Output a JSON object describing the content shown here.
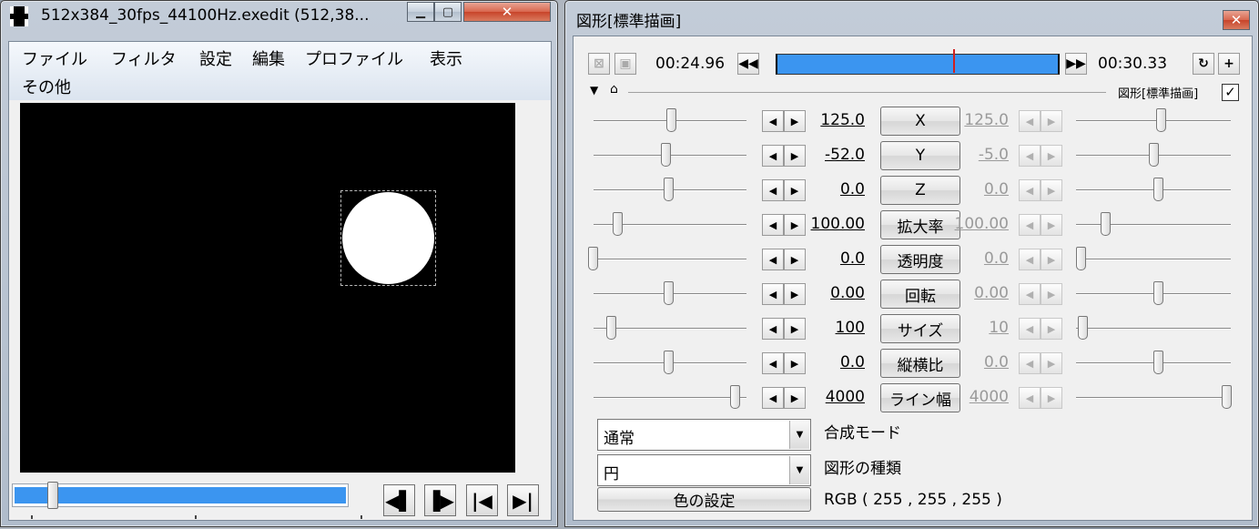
{
  "left_window": {
    "title": "512x384_30fps_44100Hz.exedit (512,38...",
    "menu": [
      "ファイル",
      "フィルタ",
      "設定",
      "編集",
      "プロファイル",
      "表示",
      "その他"
    ],
    "nav_buttons": [
      "◀▌",
      "▐▶",
      "|◀",
      "▶|"
    ]
  },
  "right_window": {
    "title": "図形[標準描画]",
    "time_start": "00:24.96",
    "time_end": "00:30.33",
    "timebar_position": 0.63,
    "object_label": "図形[標準描画]",
    "object_checked": "✓",
    "params": [
      {
        "name": "X",
        "start": "125.0",
        "end": "125.0",
        "thumb_l": 0.55,
        "thumb_r": 0.55
      },
      {
        "name": "Y",
        "start": "-52.0",
        "end": "-5.0",
        "thumb_l": 0.51,
        "thumb_r": 0.5
      },
      {
        "name": "Z",
        "start": "0.0",
        "end": "0.0",
        "thumb_l": 0.53,
        "thumb_r": 0.53
      },
      {
        "name": "拡大率",
        "start": "100.00",
        "end": "100.00",
        "thumb_l": 0.17,
        "thumb_r": 0.17
      },
      {
        "name": "透明度",
        "start": "0.0",
        "end": "0.0",
        "thumb_l": 0.0,
        "thumb_r": 0.0
      },
      {
        "name": "回転",
        "start": "0.00",
        "end": "0.00",
        "thumb_l": 0.53,
        "thumb_r": 0.53
      },
      {
        "name": "サイズ",
        "start": "100",
        "end": "10",
        "thumb_l": 0.13,
        "thumb_r": 0.01
      },
      {
        "name": "縦横比",
        "start": "0.0",
        "end": "0.0",
        "thumb_l": 0.53,
        "thumb_r": 0.53
      },
      {
        "name": "ライン幅",
        "start": "4000",
        "end": "4000",
        "thumb_l": 1.0,
        "thumb_r": 1.0
      }
    ],
    "blend_mode_value": "通常",
    "blend_mode_label": "合成モード",
    "shape_type_value": "円",
    "shape_type_label": "図形の種類",
    "color_button": "色の設定",
    "color_value": "RGB ( 255 , 255 , 255 )"
  },
  "colors": {
    "accent_blue": "#3b95f0",
    "preview_bg": "#000000",
    "shape_fill": "#ffffff"
  }
}
